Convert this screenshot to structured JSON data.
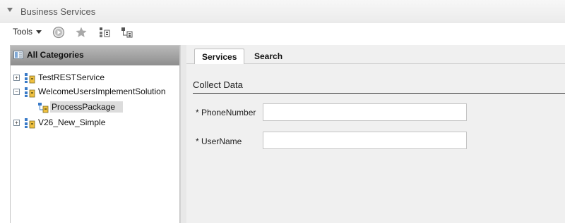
{
  "panel": {
    "title": "Business Services"
  },
  "toolbar": {
    "tools_label": "Tools",
    "icons": [
      "play-circle-icon",
      "star-icon",
      "service-tree-icon",
      "service-hierarchy-icon"
    ]
  },
  "categories": {
    "header": "All Categories",
    "nodes": [
      {
        "label": "TestRESTService",
        "expander": "+"
      },
      {
        "label": "WelcomeUsersImplementSolution",
        "expander": "−"
      },
      {
        "label": "ProcessPackage",
        "selected": true
      },
      {
        "label": "V26_New_Simple",
        "expander": "+"
      }
    ]
  },
  "tabs": [
    {
      "label": "Services",
      "active": true
    },
    {
      "label": "Search",
      "active": false
    }
  ],
  "form": {
    "section_title": "Collect Data",
    "fields": [
      {
        "label": "* PhoneNumber",
        "value": ""
      },
      {
        "label": "* UserName",
        "value": ""
      }
    ]
  },
  "colors": {
    "header_gradient": "#8e8e8e",
    "selection": "#dcdcdc",
    "panel_bg": "#f0f0f0"
  }
}
